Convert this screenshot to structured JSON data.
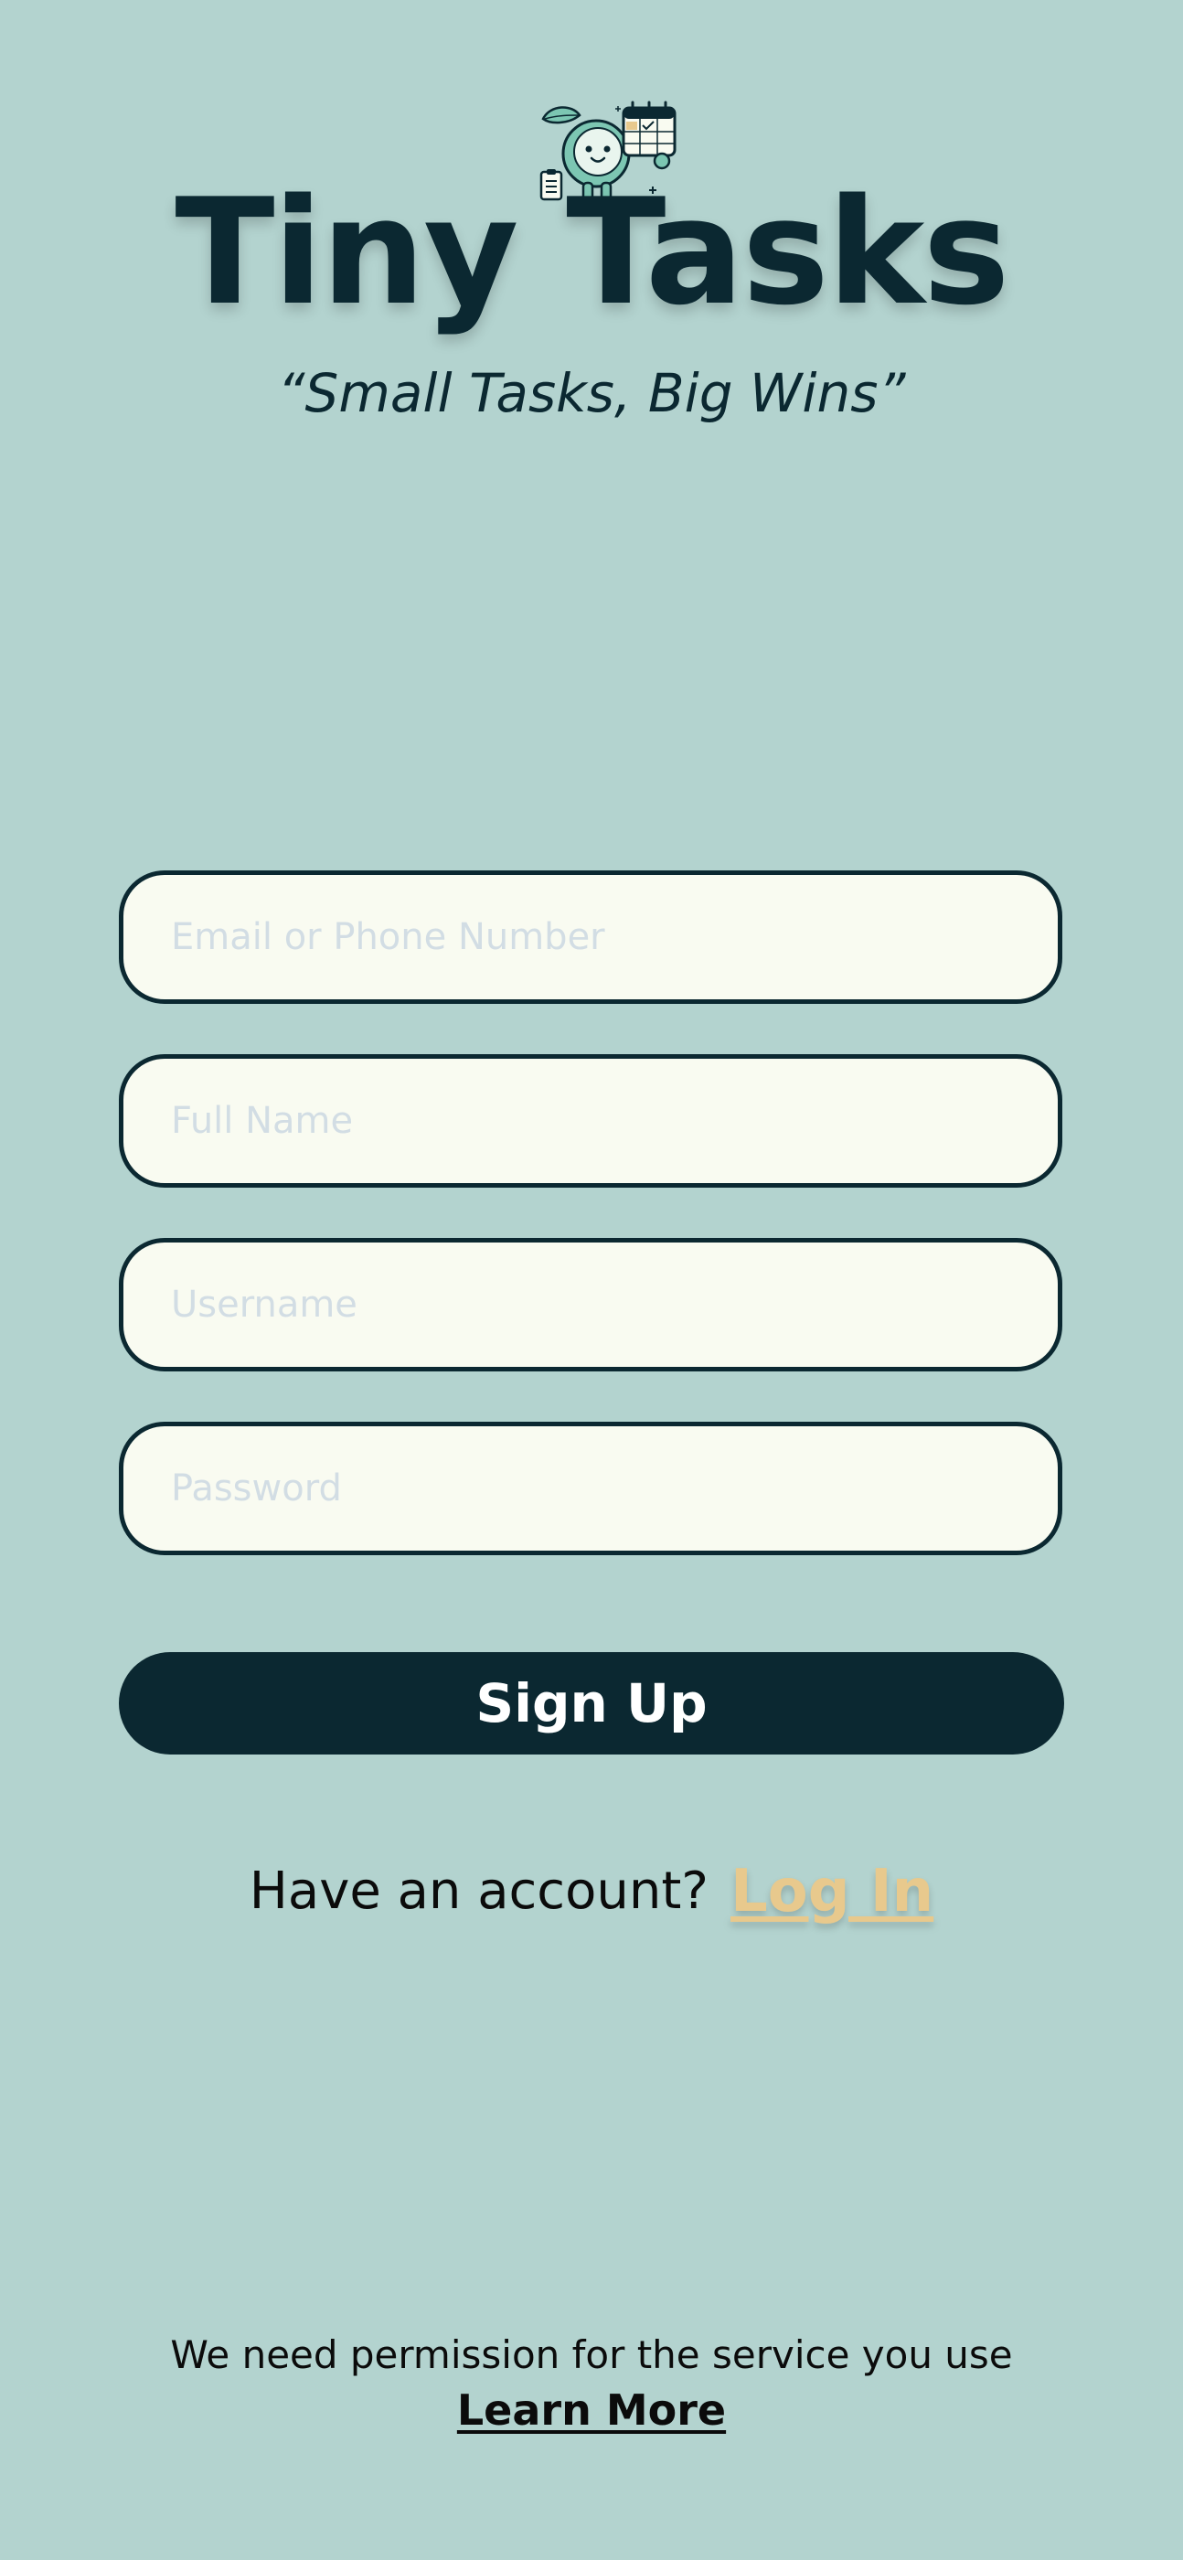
{
  "app": {
    "title": "Tiny Tasks",
    "tagline": "“Small Tasks, Big Wins”",
    "logo_icon": "mascot-with-calendar-icon"
  },
  "form": {
    "email_placeholder": "Email or Phone Number",
    "fullname_placeholder": "Full Name",
    "username_placeholder": "Username",
    "password_placeholder": "Password",
    "signup_label": "Sign Up"
  },
  "login": {
    "prompt": "Have an account?",
    "link_label": "Log In"
  },
  "footer": {
    "permission_text": "We need permission for the service you use",
    "learn_more_label": "Learn More"
  },
  "colors": {
    "background": "#b3d3cf",
    "primary": "#0b2831",
    "field_fill": "#f9fbf1",
    "placeholder": "#d2dde4",
    "login_accent": "#e8c98d"
  }
}
